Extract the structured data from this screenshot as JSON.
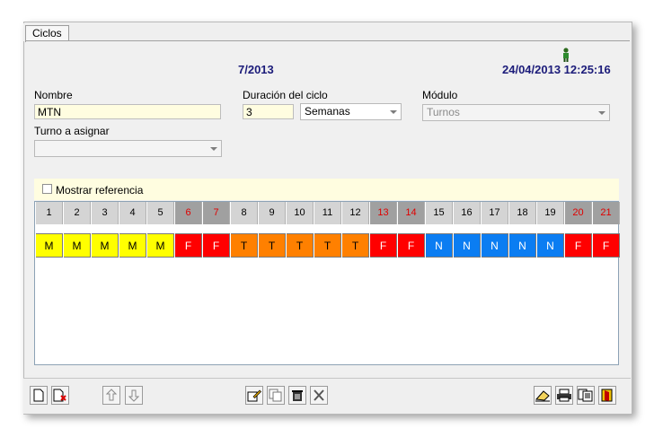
{
  "tabs": [
    {
      "label": "Ciclos"
    }
  ],
  "header": {
    "period": "7/2013",
    "datetime": "24/04/2013 12:25:16"
  },
  "form": {
    "nombre_label": "Nombre",
    "nombre_value": "MTN",
    "duracion_label": "Duración del ciclo",
    "duracion_value": "3",
    "unidad_value": "Semanas",
    "modulo_label": "Módulo",
    "modulo_value": "Turnos",
    "turno_label": "Turno a asignar",
    "turno_value": ""
  },
  "reference": {
    "label": "Mostrar referencia",
    "checked": false
  },
  "cycle": {
    "days": [
      "1",
      "2",
      "3",
      "4",
      "5",
      "6",
      "7",
      "8",
      "9",
      "10",
      "11",
      "12",
      "13",
      "14",
      "15",
      "16",
      "17",
      "18",
      "19",
      "20",
      "21"
    ],
    "shifts": [
      "M",
      "M",
      "M",
      "M",
      "M",
      "F",
      "F",
      "T",
      "T",
      "T",
      "T",
      "T",
      "F",
      "F",
      "N",
      "N",
      "N",
      "N",
      "N",
      "F",
      "F"
    ],
    "weekend_days": [
      6,
      7,
      13,
      14,
      20,
      21
    ]
  },
  "colors": {
    "M": "#ffff00",
    "T": "#ff8000",
    "N": "#0b7df2",
    "F": "#ff0000",
    "header_weekday": "#d4d4d4",
    "header_weekend": "#a0a0a0",
    "weekend_text": "#e00000",
    "title_text": "#1c1c7a"
  },
  "toolbar": {
    "left": [
      {
        "icon": "new-document-icon"
      },
      {
        "icon": "delete-document-icon"
      }
    ],
    "move": [
      {
        "icon": "arrow-up-icon"
      },
      {
        "icon": "arrow-down-icon"
      }
    ],
    "middle": [
      {
        "icon": "edit-icon"
      },
      {
        "icon": "copy-icon"
      },
      {
        "icon": "trash-icon"
      },
      {
        "icon": "clear-icon"
      }
    ],
    "right": [
      {
        "icon": "eraser-icon"
      },
      {
        "icon": "print-icon"
      },
      {
        "icon": "copy-pages-icon"
      },
      {
        "icon": "exit-door-icon"
      }
    ]
  }
}
